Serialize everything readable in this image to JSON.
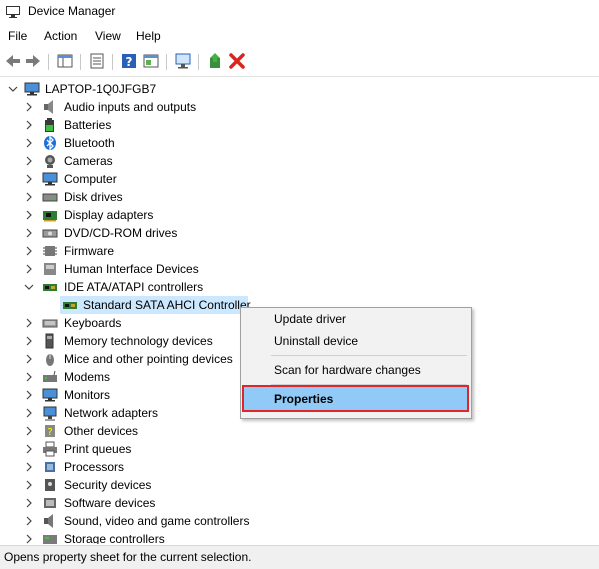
{
  "window": {
    "title": "Device Manager"
  },
  "menu": [
    "File",
    "Action",
    "View",
    "Help"
  ],
  "toolbar": {
    "icons": [
      "back-arrow-icon",
      "forward-arrow-icon",
      "show-hide-tree-icon",
      "properties-sheet-icon",
      "help-icon",
      "console-tree-icon",
      "scan-hardware-icon",
      "update-driver-icon",
      "uninstall-x-icon"
    ]
  },
  "tree": {
    "root": "LAPTOP-1Q0JFGB7",
    "categories": [
      {
        "label": "Audio inputs and outputs",
        "icon": "speaker-icon"
      },
      {
        "label": "Batteries",
        "icon": "battery-icon"
      },
      {
        "label": "Bluetooth",
        "icon": "bluetooth-icon"
      },
      {
        "label": "Cameras",
        "icon": "camera-icon"
      },
      {
        "label": "Computer",
        "icon": "monitor-icon"
      },
      {
        "label": "Disk drives",
        "icon": "disk-drive-icon"
      },
      {
        "label": "Display adapters",
        "icon": "display-adapter-icon"
      },
      {
        "label": "DVD/CD-ROM drives",
        "icon": "dvd-drive-icon"
      },
      {
        "label": "Firmware",
        "icon": "firmware-icon"
      },
      {
        "label": "Human Interface Devices",
        "icon": "hid-icon"
      },
      {
        "label": "IDE ATA/ATAPI controllers",
        "icon": "controller-icon",
        "expanded": true
      },
      {
        "label": "Standard SATA AHCI Controller",
        "icon": "controller-icon",
        "child": true,
        "selected": true
      },
      {
        "label": "Keyboards",
        "icon": "keyboard-icon"
      },
      {
        "label": "Memory technology devices",
        "icon": "memory-icon"
      },
      {
        "label": "Mice and other pointing devices",
        "icon": "mouse-icon"
      },
      {
        "label": "Modems",
        "icon": "modem-icon"
      },
      {
        "label": "Monitors",
        "icon": "monitor-icon"
      },
      {
        "label": "Network adapters",
        "icon": "network-icon"
      },
      {
        "label": "Other devices",
        "icon": "other-device-icon"
      },
      {
        "label": "Print queues",
        "icon": "printer-icon"
      },
      {
        "label": "Processors",
        "icon": "processor-icon"
      },
      {
        "label": "Security devices",
        "icon": "security-icon"
      },
      {
        "label": "Software devices",
        "icon": "software-icon"
      },
      {
        "label": "Sound, video and game controllers",
        "icon": "sound-icon"
      },
      {
        "label": "Storage controllers",
        "icon": "storage-icon"
      }
    ]
  },
  "context_menu": {
    "update_driver": "Update driver",
    "uninstall_device": "Uninstall device",
    "scan": "Scan for hardware changes",
    "properties": "Properties"
  },
  "status": "Opens property sheet for the current selection.",
  "colors": {
    "selection": "#cce8ff",
    "menu_highlight": "#91c9f7",
    "annotation": "#e0252b"
  }
}
